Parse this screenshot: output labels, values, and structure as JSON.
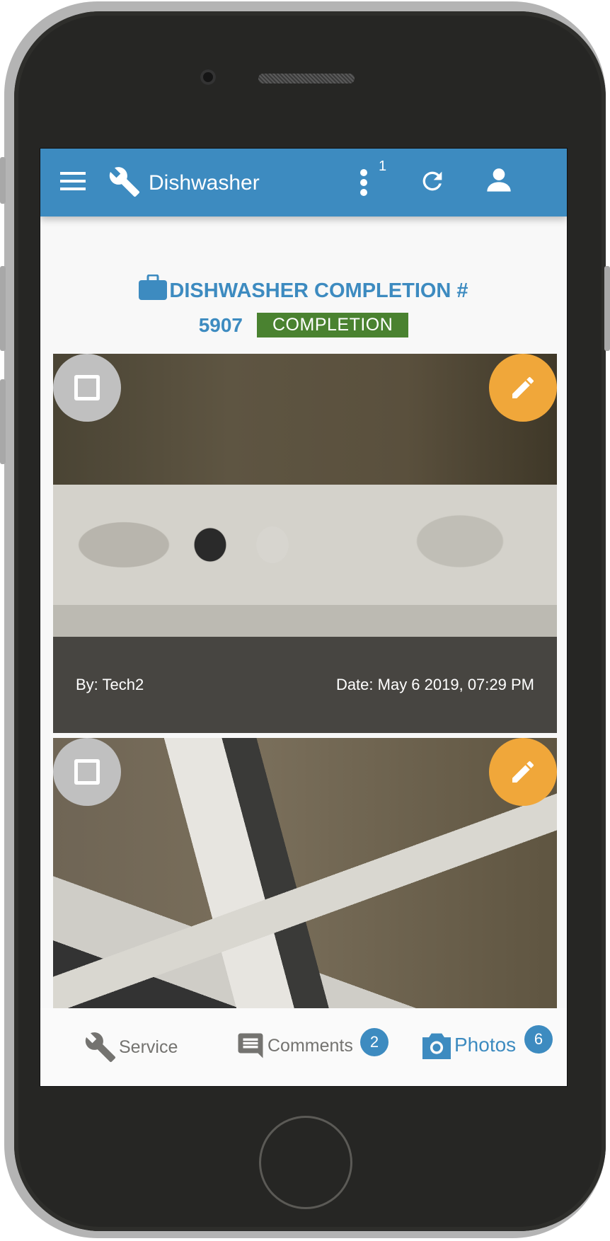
{
  "header": {
    "title": "Dishwasher",
    "menu_icon": "hamburger-icon",
    "app_icon": "wrench-icon",
    "more_icon": "more-vertical-icon",
    "more_count": "1",
    "refresh_icon": "refresh-icon",
    "profile_icon": "user-icon"
  },
  "job": {
    "icon": "briefcase-icon",
    "title": "DISHWASHER COMPLETION #",
    "number": "5907",
    "status": "COMPLETION",
    "status_color": "#4a8230"
  },
  "photos": [
    {
      "by": "By: Tech2",
      "date": "Date: May 6 2019, 07:29 PM",
      "select_icon": "checkbox-unchecked-icon",
      "edit_icon": "pencil-icon"
    },
    {
      "select_icon": "checkbox-unchecked-icon",
      "edit_icon": "pencil-icon"
    }
  ],
  "bottom_nav": {
    "items": [
      {
        "label": "Service",
        "icon": "wrench-icon",
        "active": false
      },
      {
        "label": "Comments",
        "icon": "comment-icon",
        "badge": "2",
        "active": false
      },
      {
        "label": "Photos",
        "icon": "camera-icon",
        "badge": "6",
        "active": true
      }
    ]
  },
  "colors": {
    "primary": "#3d8bc0",
    "edit_button": "#f0a73a",
    "select_button": "#c0c0c0",
    "nav_inactive": "#747370"
  }
}
